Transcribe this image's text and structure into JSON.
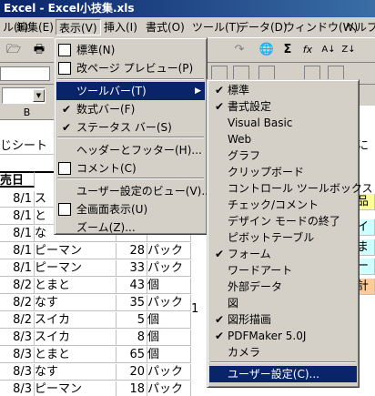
{
  "window": {
    "title": "Excel - Excel小技集.xls"
  },
  "menubar": [
    "ル(F)",
    "編集(E)",
    "表示(V)",
    "挿入(I)",
    "書式(O)",
    "ツール(T)",
    "データ(D)",
    "ウィンドウ(W)",
    "ヘルプ"
  ],
  "toolbar": {
    "icons": [
      "open-icon",
      "print-icon",
      "redo-icon",
      "web-icon",
      "autosum-icon",
      "function-icon",
      "sort-ascending-icon",
      "sort-descending-icon"
    ],
    "glyphs": [
      "🗁",
      "🖶",
      "↷",
      "🌐",
      "Σ",
      "fx",
      "A↓",
      "Z↓"
    ]
  },
  "sheet": {
    "col_header": "B",
    "row1_text": "じシート",
    "header_cell": "売日",
    "rows": [
      {
        "date": "8/1",
        "item": "ス",
        "qty": "",
        "unit": ""
      },
      {
        "date": "8/1",
        "item": "と",
        "qty": "",
        "unit": ""
      },
      {
        "date": "8/1",
        "item": "な",
        "qty": "",
        "unit": ""
      },
      {
        "date": "8/1",
        "item": "ピーマン",
        "qty": "28",
        "unit": "パック"
      },
      {
        "date": "8/1",
        "item": "ピーマン",
        "qty": "33",
        "unit": "パック"
      },
      {
        "date": "8/2",
        "item": "とまと",
        "qty": "43",
        "unit": "個"
      },
      {
        "date": "8/2",
        "item": "なす",
        "qty": "35",
        "unit": "パック"
      },
      {
        "date": "8/2",
        "item": "スイカ",
        "qty": "5",
        "unit": "個"
      },
      {
        "date": "8/3",
        "item": "スイカ",
        "qty": "8",
        "unit": "個"
      },
      {
        "date": "8/3",
        "item": "とまと",
        "qty": "65",
        "unit": "個"
      },
      {
        "date": "8/3",
        "item": "なす",
        "qty": "20",
        "unit": "パック"
      },
      {
        "date": "8/3",
        "item": "ピーマン",
        "qty": "18",
        "unit": "パック"
      }
    ],
    "stray_value": "1",
    "right_cells": [
      "に",
      "品",
      "イ",
      "ま",
      "ー",
      "計"
    ]
  },
  "view_menu": {
    "items": [
      {
        "label": "標準(N)",
        "icon": "normal-view-icon"
      },
      {
        "label": "改ページ プレビュー(P)",
        "icon": "page-break-preview-icon"
      },
      {
        "label": "ツールバー(T)",
        "highlighted": true,
        "submenu": true
      },
      {
        "label": "数式バー(F)",
        "checked": true
      },
      {
        "label": "ステータス バー(S)",
        "checked": true
      },
      {
        "label": "ヘッダーとフッター(H)..."
      },
      {
        "label": "コメント(C)",
        "icon": "comment-icon"
      },
      {
        "label": "ユーザー設定のビュー(V)..."
      },
      {
        "label": "全画面表示(U)",
        "icon": "full-screen-icon"
      },
      {
        "label": "ズーム(Z)..."
      }
    ]
  },
  "toolbar_submenu": {
    "items": [
      {
        "label": "標準",
        "checked": true
      },
      {
        "label": "書式設定",
        "checked": true
      },
      {
        "label": "Visual Basic"
      },
      {
        "label": "Web"
      },
      {
        "label": "グラフ"
      },
      {
        "label": "クリップボード"
      },
      {
        "label": "コントロール ツールボックス"
      },
      {
        "label": "チェック/コメント"
      },
      {
        "label": "デザイン モードの終了"
      },
      {
        "label": "ピボットテーブル"
      },
      {
        "label": "フォーム",
        "checked": true
      },
      {
        "label": "ワードアート"
      },
      {
        "label": "外部データ"
      },
      {
        "label": "図"
      },
      {
        "label": "図形描画",
        "checked": true
      },
      {
        "label": "PDFMaker 5.0J",
        "checked": true
      },
      {
        "label": "カメラ"
      },
      {
        "label": "ユーザー設定(C)...",
        "highlighted": true
      }
    ]
  },
  "colors": {
    "titlebar": "#0a246a",
    "highlight": "#0a246a",
    "cell_fill": "#ffff99",
    "cell_fill2": "#ccffff",
    "cell_fill3": "#ffcc99"
  }
}
